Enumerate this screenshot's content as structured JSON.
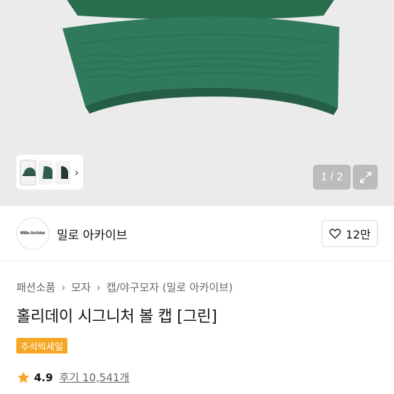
{
  "gallery": {
    "counter": "1 / 2"
  },
  "store": {
    "logo_text": "Millo Archive",
    "name": "밀로 아카이브",
    "like_count": "12만"
  },
  "product": {
    "breadcrumb": [
      "패션소품",
      "모자",
      "캡/야구모자 (밀로 아카이브)"
    ],
    "title": "홀리데이 시그니처 볼 캡 [그린]",
    "badge": "추석빅세일",
    "rating": "4.9",
    "reviews": "후기 10,541개"
  },
  "colors": {
    "cap_green": "#2f7a5a",
    "badge": "#f5a623",
    "star": "#f5a623"
  }
}
